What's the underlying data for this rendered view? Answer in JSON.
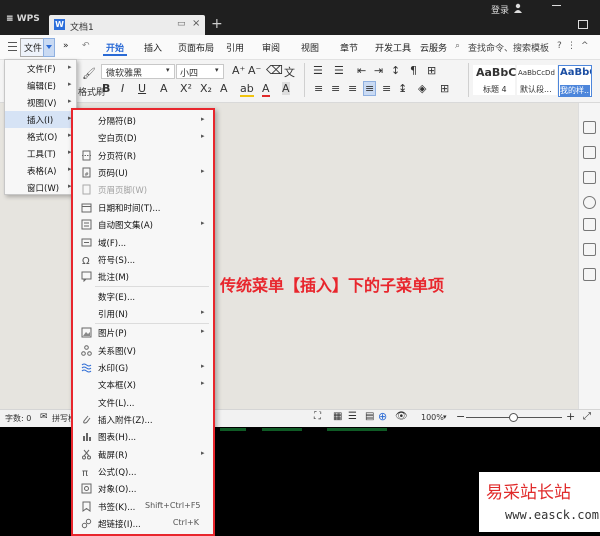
{
  "titlebar": {
    "app_name": "WPS",
    "doc_tab": "文档1",
    "login": "登录"
  },
  "menubar": {
    "file": "文件",
    "more": "»",
    "tabs": [
      "开始",
      "插入",
      "页面布局",
      "引用",
      "审阅",
      "视图",
      "章节",
      "开发工具",
      "云服务"
    ],
    "search_placeholder": "查找命令、搜索模板",
    "collapse": "^"
  },
  "ribbon": {
    "font_name": "微软雅黑",
    "font_size": "小四",
    "format_painter": "格式刷",
    "style_samples": [
      {
        "sample": "AaBbC",
        "name": "标题 4"
      },
      {
        "sample": "AaBbCcDd",
        "name": "默认段..."
      },
      {
        "sample": "AaBbC",
        "name": "我的样..."
      }
    ]
  },
  "main_menu": [
    {
      "label": "文件(F)",
      "arrow": "▸"
    },
    {
      "label": "编辑(E)",
      "arrow": "▸"
    },
    {
      "label": "视图(V)",
      "arrow": "▸"
    },
    {
      "label": "插入(I)",
      "arrow": "▸"
    },
    {
      "label": "格式(O)",
      "arrow": "▸"
    },
    {
      "label": "工具(T)",
      "arrow": "▸"
    },
    {
      "label": "表格(A)",
      "arrow": "▸"
    },
    {
      "label": "窗口(W)",
      "arrow": "▸"
    }
  ],
  "insert_menu": [
    {
      "label": "分隔符(B)",
      "arrow": "▸"
    },
    {
      "label": "空白页(D)",
      "arrow": "▸"
    },
    {
      "label": "分页符(R)"
    },
    {
      "label": "页码(U)",
      "arrow": "▸"
    },
    {
      "label": "页眉页脚(W)",
      "disabled": true
    },
    {
      "label": "日期和时间(T)..."
    },
    {
      "label": "自动图文集(A)",
      "arrow": "▸"
    },
    {
      "label": "域(F)..."
    },
    {
      "label": "符号(S)..."
    },
    {
      "label": "批注(M)"
    },
    {
      "label": "数字(E)..."
    },
    {
      "label": "引用(N)",
      "arrow": "▸"
    },
    {
      "label": "图片(P)",
      "arrow": "▸"
    },
    {
      "label": "关系图(V)"
    },
    {
      "label": "水印(G)",
      "arrow": "▸"
    },
    {
      "label": "文本框(X)",
      "arrow": "▸"
    },
    {
      "label": "文件(L)..."
    },
    {
      "label": "插入附件(Z)..."
    },
    {
      "label": "图表(H)..."
    },
    {
      "label": "截屏(R)",
      "arrow": "▸"
    },
    {
      "label": "公式(Q)..."
    },
    {
      "label": "对象(O)..."
    },
    {
      "label": "书签(K)...",
      "shortcut": "Shift+Ctrl+F5"
    },
    {
      "label": "超链接(I)...",
      "shortcut": "Ctrl+K"
    }
  ],
  "caption": "传统菜单【插入】下的子菜单项",
  "statusbar": {
    "word_count": "字数: 0",
    "spell": "拼写检",
    "zoom": "100%",
    "zoom_minus": "−",
    "zoom_plus": "+"
  },
  "watermark": {
    "cn": "易采站长站",
    "en": "www.easck.com"
  },
  "colors": {
    "accent": "#2a6ad5",
    "highlight": "#e8262d",
    "titlebar": "#1f1f1f"
  }
}
